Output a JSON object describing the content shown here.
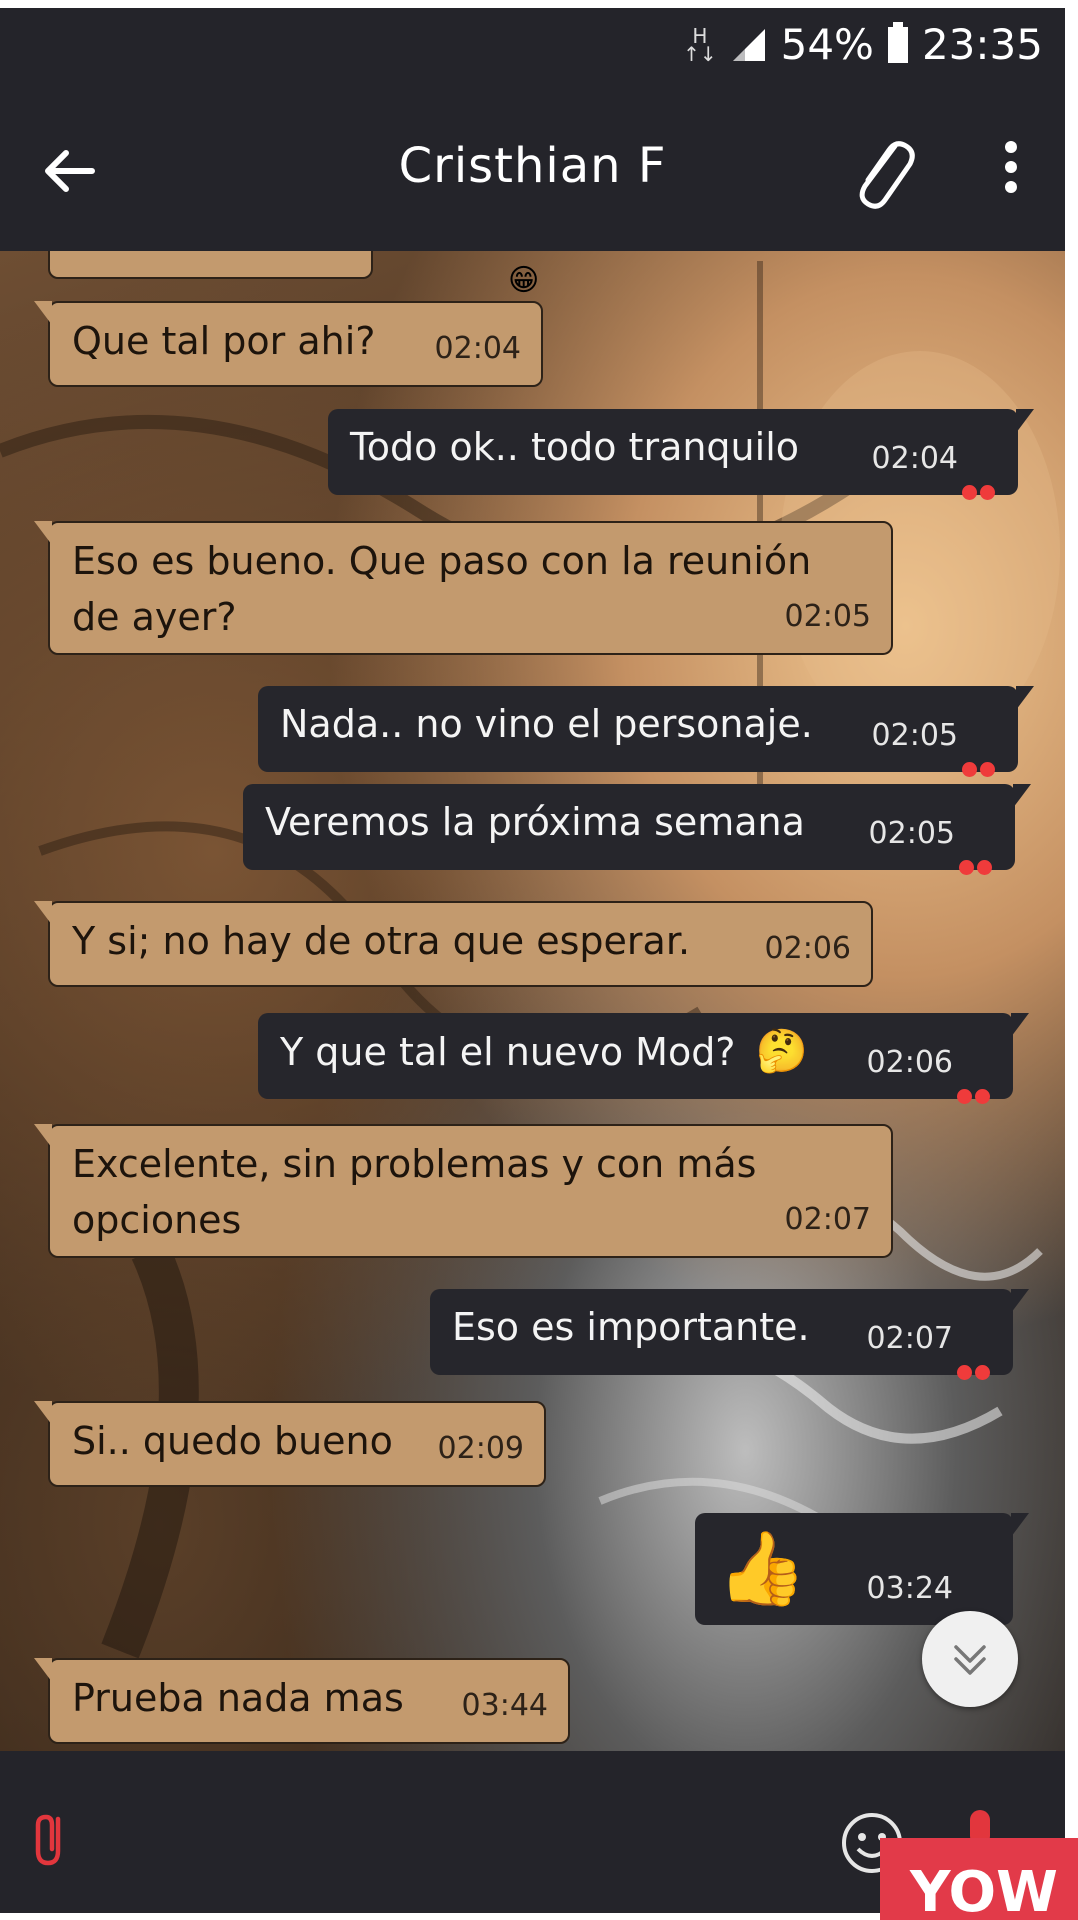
{
  "status_bar": {
    "network": "H",
    "battery": "54%",
    "clock": "23:35"
  },
  "header": {
    "contact_name": "Cristhian F"
  },
  "messages": [
    {
      "dir": "in",
      "text": "Que tal por ahi?",
      "time": "02:04"
    },
    {
      "dir": "out",
      "text": "Todo ok.. todo tranquilo",
      "time": "02:04"
    },
    {
      "dir": "in",
      "text_line1": "Eso es bueno. Que paso con la reunión",
      "text_line2": "de ayer?",
      "time": "02:05"
    },
    {
      "dir": "out",
      "text": "Nada.. no vino el personaje.",
      "time": "02:05"
    },
    {
      "dir": "out",
      "text": "Veremos la próxima semana",
      "time": "02:05"
    },
    {
      "dir": "in",
      "text": "Y si; no hay de otra que esperar.",
      "time": "02:06"
    },
    {
      "dir": "out",
      "text": "Y que tal el nuevo Mod?",
      "emoji": "🤔",
      "time": "02:06"
    },
    {
      "dir": "in",
      "text_line1": "Excelente, sin problemas y con más",
      "text_line2": "opciones",
      "time": "02:07"
    },
    {
      "dir": "out",
      "text": "Eso es importante.",
      "time": "02:07"
    },
    {
      "dir": "in",
      "text": "Si.. quedo bueno",
      "time": "02:09"
    },
    {
      "dir": "out",
      "emoji": "👍",
      "time": "03:24"
    },
    {
      "dir": "in",
      "text": "Prueba nada mas",
      "time": "03:44"
    }
  ],
  "floating_emoji": "😁",
  "watermark": "YOW",
  "colors": {
    "bar": "#24242a",
    "incoming_bubble": "#c39a6e",
    "outgoing_bubble": "#26262c",
    "read_ticks": "#ef3b3b",
    "mic": "#e2363d"
  },
  "icons": [
    "back-arrow-icon",
    "paperclip-icon",
    "more-vert-icon",
    "scroll-down-icon",
    "emoji-icon",
    "mic-icon"
  ]
}
